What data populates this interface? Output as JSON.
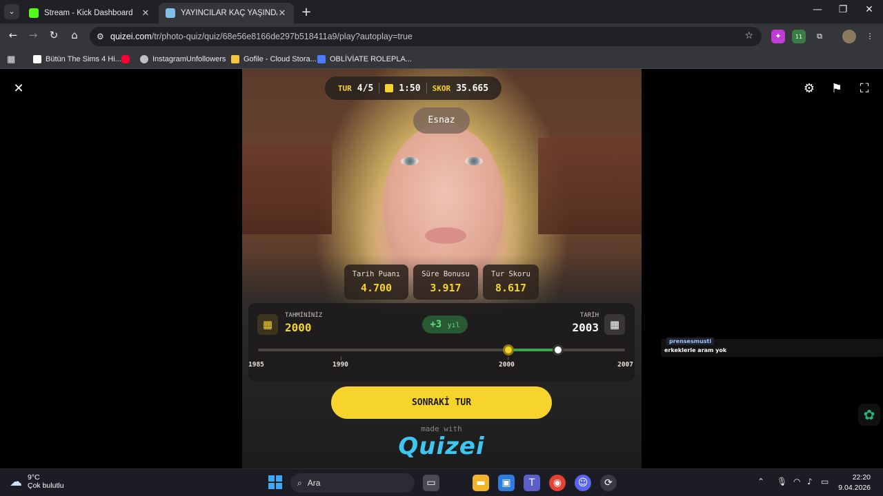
{
  "browser": {
    "tabs": [
      {
        "title": "Stream - Kick Dashboard",
        "active": false,
        "favicon_color": "#53fc18"
      },
      {
        "title": "YAYINCILAR KAÇ YAŞINDA ? - Q",
        "active": true,
        "favicon_color": "#7fbfe8"
      }
    ],
    "url_domain": "quizei.com",
    "url_path": "/tr/photo-quiz/quiz/68e56e8166de297b518411a9/play?autoplay=true",
    "bookmarks": [
      {
        "label": "Bütün The Sims 4 Hi...",
        "icon_color": "#ffffff"
      },
      {
        "label": "",
        "icon_color": "#ff0033"
      },
      {
        "label": "InstagramUnfollowers",
        "icon_color": "#bdc1c6"
      },
      {
        "label": "Gofile - Cloud Stora...",
        "icon_color": "#f4c542"
      },
      {
        "label": "OBLİVİATE ROLEPLA...",
        "icon_color": "#4f7bff"
      }
    ],
    "extension_badge": "11"
  },
  "quiz": {
    "round_label": "TUR",
    "round_value": "4/5",
    "timer": "1:50",
    "score_label": "SKOR",
    "score_value": "35.665",
    "category": "Esnaz",
    "cards": [
      {
        "label": "Tarih Puanı",
        "value": "4.700"
      },
      {
        "label": "Süre Bonusu",
        "value": "3.917"
      },
      {
        "label": "Tur Skoru",
        "value": "8.617"
      }
    ],
    "guess_label": "TAHMİNİNİZ",
    "guess_value": "2000",
    "answer_label": "TARİH",
    "answer_value": "2003",
    "difference": "+3",
    "difference_unit": "yıl",
    "timeline": {
      "min": 1985,
      "max": 2007,
      "guess": 2000,
      "answer": 2003
    },
    "ticks": [
      "1985",
      "1990",
      "2000",
      "2007"
    ],
    "next_button": "SONRAKİ TUR",
    "made_with": "made with",
    "logo": "Quizei"
  },
  "chat_overlay": {
    "user": "prensesmusti",
    "message": "erkeklerle aram yok"
  },
  "taskbar": {
    "temperature": "9°C",
    "weather": "Çok bulutlu",
    "search_placeholder": "Ara",
    "time": "22:20",
    "date": "9.04.2026"
  },
  "colors": {
    "accent_yellow": "#f6d32d",
    "accent_green": "#3aa34e",
    "logo_blue": "#3ec6f0"
  }
}
